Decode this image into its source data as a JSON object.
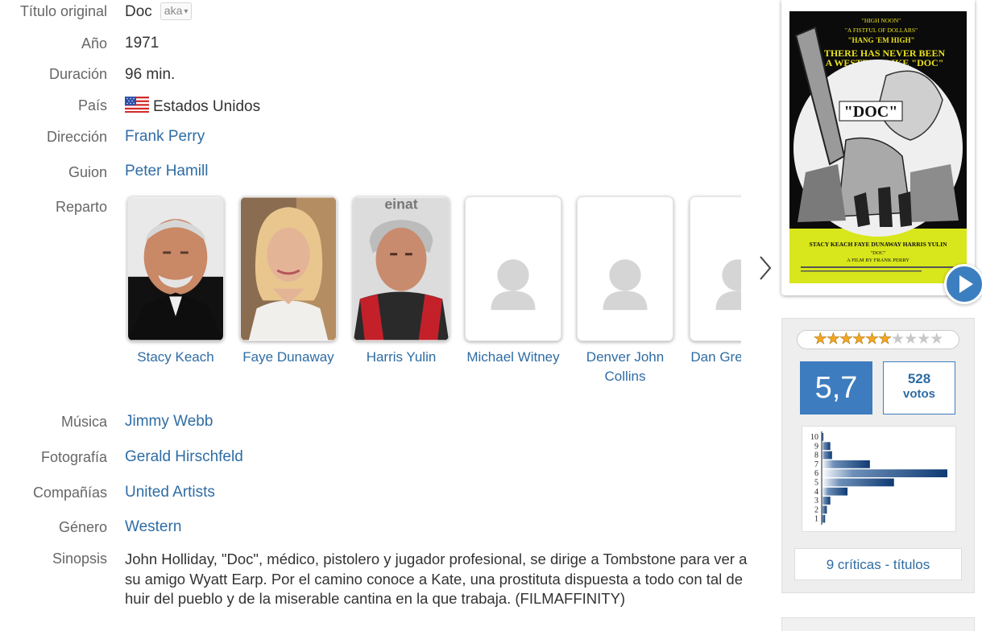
{
  "details": {
    "original_title": {
      "label": "Título original",
      "value": "Doc",
      "aka": "aka"
    },
    "year": {
      "label": "Año",
      "value": "1971"
    },
    "duration": {
      "label": "Duración",
      "value": "96 min."
    },
    "country": {
      "label": "País",
      "value": "Estados Unidos",
      "flag": "us-flag-icon"
    },
    "direction": {
      "label": "Dirección",
      "value": "Frank Perry"
    },
    "screenplay": {
      "label": "Guion",
      "value": "Peter Hamill"
    },
    "cast_label": "Reparto",
    "music": {
      "label": "Música",
      "value": "Jimmy Webb"
    },
    "photography": {
      "label": "Fotografía",
      "value": "Gerald Hirschfeld"
    },
    "companies": {
      "label": "Compañías",
      "value": "United Artists"
    },
    "genre": {
      "label": "Género",
      "value": "Western"
    },
    "synopsis": {
      "label": "Sinopsis",
      "value": "John Holliday, \"Doc\", médico, pistolero y jugador profesional, se dirige a Tombstone para ver a su amigo Wyatt Earp. Por el camino conoce a Kate, una prostituta dispuesta a todo con tal de huir del pueblo y de la miserable cantina en la que trabaja. (FILMAFFINITY)"
    }
  },
  "cast": [
    {
      "name": "Stacy Keach",
      "photo": "photo"
    },
    {
      "name": "Faye Dunaway",
      "photo": "photo"
    },
    {
      "name": "Harris Yulin",
      "photo": "photo"
    },
    {
      "name": "Michael Witney",
      "photo": "placeholder"
    },
    {
      "name": "Denver John Collins",
      "photo": "placeholder"
    },
    {
      "name": "Dan Greenburg",
      "photo": "placeholder"
    }
  ],
  "poster": {
    "tagline_lines": [
      "\"HIGH NOON\"",
      "\"A FISTFUL OF DOLLARS\"",
      "\"HANG 'EM HIGH\""
    ],
    "headline_lines": [
      "THERE HAS NEVER BEEN",
      "A WESTERN LIKE \"DOC\""
    ],
    "title": "\"DOC\"",
    "credits_line": "STACY KEACH  FAYE DUNAWAY  HARRIS YULIN",
    "film_title_small": "\"DOC\"",
    "director_line": "A FILM BY FRANK PERRY"
  },
  "rating": {
    "stars_filled": 6,
    "stars_total": 10,
    "average": "5,7",
    "votes_count": "528",
    "votes_label": "votos",
    "histogram": {
      "labels": [
        "10",
        "9",
        "8",
        "7",
        "6",
        "5",
        "4",
        "3",
        "2",
        "1"
      ],
      "values": [
        1,
        5,
        6,
        28,
        73,
        42,
        15,
        5,
        3,
        2
      ]
    },
    "reviews_link": "9 críticas - títulos"
  },
  "colors": {
    "link": "#2e6ca4",
    "accent": "#3d7cbe",
    "histogram_bar": "#13407a",
    "star": "#f5a623"
  }
}
